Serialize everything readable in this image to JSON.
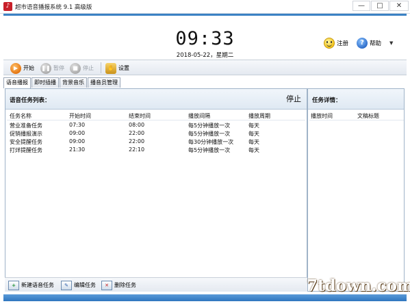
{
  "window": {
    "title": "超市语音播报系统 9.1 高级版",
    "app_icon": "app-logo-icon",
    "min_glyph": "—",
    "max_glyph": "□",
    "close_glyph": "✕"
  },
  "header": {
    "time": "09:33",
    "date": "2018-05-22，星期二",
    "register_label": "注册",
    "help_label": "帮助",
    "help_arrow": "▼"
  },
  "toolbar": {
    "start_label": "开始",
    "pause_label": "暂停",
    "stop_label": "停止",
    "settings_label": "设置"
  },
  "tabs": [
    "语音播报",
    "即时插播",
    "背景音乐",
    "播音员管理"
  ],
  "task_panel": {
    "title": "语音任务列表：",
    "state": "停止",
    "columns": [
      "任务名称",
      "开始时间",
      "结束时间",
      "播放间隔",
      "播放周期"
    ],
    "rows": [
      [
        "营业准备任务",
        "07:30",
        "08:00",
        "每5分钟播放一次",
        "每天"
      ],
      [
        "促销播报演示",
        "09:00",
        "22:00",
        "每5分钟播放一次",
        "每天"
      ],
      [
        "安全提醒任务",
        "09:00",
        "22:00",
        "每30分钟播放一次",
        "每天"
      ],
      [
        "打烊提醒任务",
        "21:30",
        "22:10",
        "每5分钟播放一次",
        "每天"
      ]
    ]
  },
  "detail_panel": {
    "title": "任务详情：",
    "columns": [
      "播放时间",
      "文稿标题"
    ]
  },
  "bottom": {
    "new_label": "新建语音任务",
    "edit_label": "编辑任务",
    "delete_label": "删除任务"
  },
  "watermark": "7tdown.com",
  "colors": {
    "accent": "#3b82c4",
    "status_bar": "#2f76bf",
    "start_icon": "#e2700b"
  }
}
